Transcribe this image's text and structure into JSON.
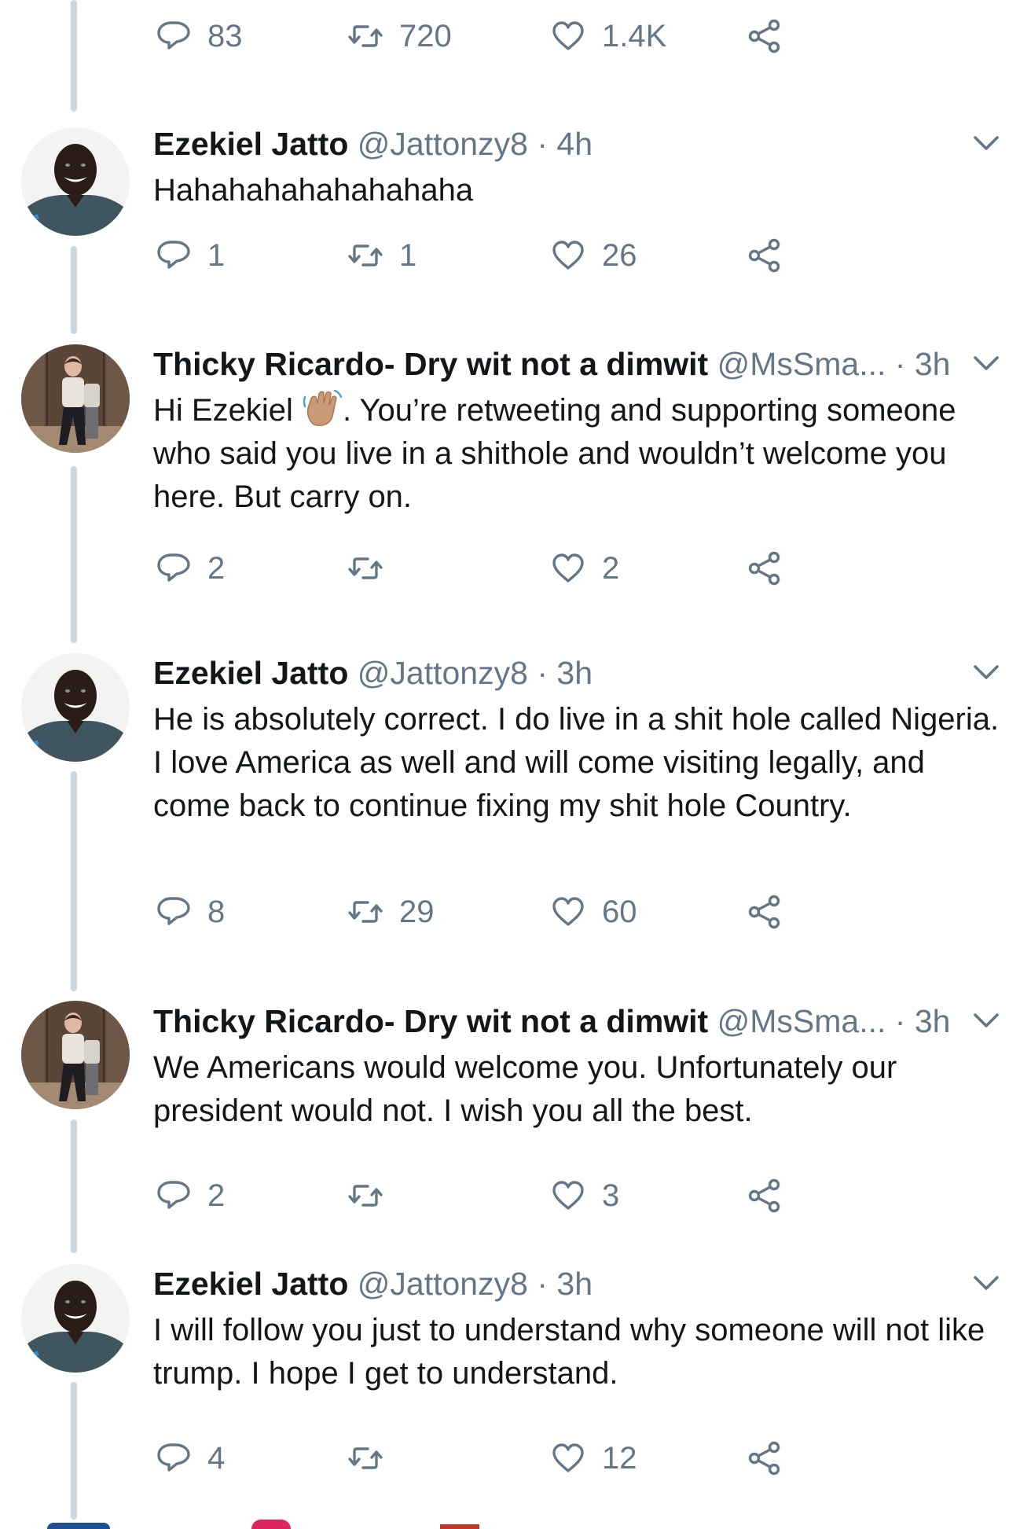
{
  "top_actions": {
    "replies": "83",
    "retweets": "720",
    "likes": "1.4K"
  },
  "tweets": [
    {
      "name": "Ezekiel Jatto",
      "handle": "@Jattonzy8",
      "dot": "·",
      "time": "4h",
      "text": "Hahahahahahahahaha",
      "replies": "1",
      "retweets": "1",
      "likes": "26"
    },
    {
      "name": "Thicky Ricardo- Dry wit not a dimwit",
      "handle": "@MsSma...",
      "dot": "·",
      "time": "3h",
      "text_before_emoji": "Hi Ezekiel ",
      "emoji": "waving-hand-emoji",
      "text_after_emoji": ". You’re retweeting and supporting someone who said you live in a shithole and wouldn’t welcome you here. But carry on.",
      "replies": "2",
      "retweets": "",
      "likes": "2"
    },
    {
      "name": "Ezekiel Jatto",
      "handle": "@Jattonzy8",
      "dot": "·",
      "time": "3h",
      "text": "He is absolutely correct. I do live in a shit hole called Nigeria. I love America as well and will come visiting legally, and come back to continue fixing my shit hole Country.",
      "replies": "8",
      "retweets": "29",
      "likes": "60"
    },
    {
      "name": "Thicky Ricardo- Dry wit not a dimwit",
      "handle": "@MsSma...",
      "dot": "·",
      "time": "3h",
      "text": "We Americans would welcome you. Unfortunately our president would not. I wish you all the best.",
      "replies": "2",
      "retweets": "",
      "likes": "3"
    },
    {
      "name": "Ezekiel Jatto",
      "handle": "@Jattonzy8",
      "dot": "·",
      "time": "3h",
      "text": "I will follow you just to understand why someone will not like trump. I hope I get to understand.",
      "replies": "4",
      "retweets": "",
      "likes": "12"
    }
  ],
  "icons": {
    "reply": "reply-icon",
    "retweet": "retweet-icon",
    "like": "heart-icon",
    "share": "share-icon",
    "caret": "chevron-down-icon"
  },
  "colors": {
    "text": "#14171a",
    "muted": "#657786",
    "thread_line": "#ccd6dd"
  }
}
